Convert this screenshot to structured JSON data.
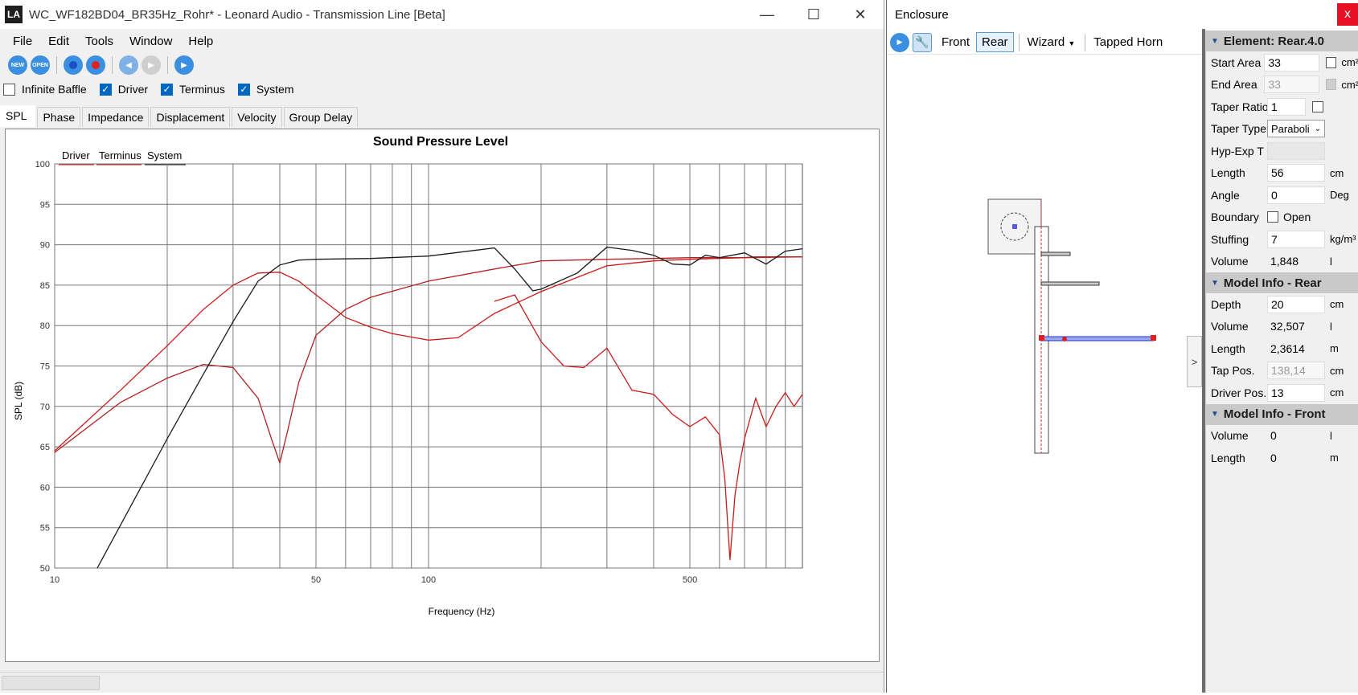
{
  "main_window": {
    "app_logo": "LA",
    "title": "WC_WF182BD04_BR35Hz_Rohr* - Leonard Audio - Transmission Line [Beta]",
    "menu": [
      "File",
      "Edit",
      "Tools",
      "Window",
      "Help"
    ],
    "toolbar_icons": [
      "new-icon",
      "open-icon",
      "record-icon",
      "stop-record-icon",
      "step-back-icon",
      "step-forward-icon",
      "play-icon"
    ],
    "toolbar_labels": {
      "new": "NEW",
      "open": "OPEN"
    },
    "checkboxes": [
      {
        "label": "Infinite Baffle",
        "checked": false
      },
      {
        "label": "Driver",
        "checked": true
      },
      {
        "label": "Terminus",
        "checked": true
      },
      {
        "label": "System",
        "checked": true
      }
    ],
    "tabs": [
      "SPL",
      "Phase",
      "Impedance",
      "Displacement",
      "Velocity",
      "Group Delay"
    ],
    "active_tab": "SPL"
  },
  "chart_data": {
    "type": "line",
    "title": "Sound Pressure Level",
    "xlabel": "Frequency (Hz)",
    "ylabel": "SPL (dB)",
    "x_scale": "log",
    "xlim": [
      10,
      1000
    ],
    "ylim": [
      50,
      100
    ],
    "x_tick_labels": [
      "10",
      "50",
      "100",
      "500"
    ],
    "x_ticks": [
      10,
      50,
      100,
      500
    ],
    "y_ticks": [
      50,
      55,
      60,
      65,
      70,
      75,
      80,
      85,
      90,
      95,
      100
    ],
    "grid": true,
    "legend_position": "top-left",
    "legend": [
      "Driver",
      "Terminus",
      "System"
    ],
    "series": [
      {
        "name": "Driver",
        "color": "#cc1a1a",
        "x": [
          10,
          15,
          20,
          25,
          30,
          35,
          40,
          45,
          50,
          60,
          70,
          80,
          100,
          120,
          150,
          200,
          300,
          400,
          500,
          700,
          1000
        ],
        "y": [
          64.5,
          72,
          77.5,
          82,
          85,
          86.5,
          86.6,
          85.5,
          83.8,
          81,
          79.8,
          79,
          78.2,
          78.5,
          81.5,
          84.2,
          87.4,
          88,
          88.2,
          88.4,
          88.5
        ]
      },
      {
        "name": "Terminus",
        "color": "#b22222",
        "x": [
          10,
          15,
          20,
          25,
          30,
          35,
          38,
          40,
          42,
          45,
          50,
          60,
          70,
          100,
          150,
          200,
          300,
          400,
          500,
          600,
          650,
          700,
          750,
          800,
          900,
          1000
        ],
        "y": [
          64.3,
          70.5,
          73.5,
          75.2,
          74.8,
          71,
          66,
          63,
          67,
          73,
          78.8,
          82,
          83.5,
          85.5,
          87,
          88,
          88.2,
          88.3,
          88.4,
          88.4,
          88.4,
          88.4,
          88.5,
          88.5,
          88.5,
          88.5
        ]
      },
      {
        "name": "System",
        "color": "#1a1a1a",
        "x": [
          13,
          20,
          25,
          30,
          35,
          40,
          45,
          50,
          70,
          100,
          150,
          170,
          190,
          200,
          250,
          300,
          350,
          400,
          450,
          500,
          550,
          600,
          700,
          800,
          900,
          1000
        ],
        "y": [
          50,
          66,
          74,
          80.5,
          85.5,
          87.5,
          88.1,
          88.2,
          88.3,
          88.6,
          89.6,
          87,
          84.3,
          84.5,
          86.5,
          89.7,
          89.3,
          88.7,
          87.6,
          87.5,
          88.7,
          88.4,
          89,
          87.6,
          89.2,
          89.5
        ]
      },
      {
        "name": "Driver-response-extra",
        "color": "#cc1a1a",
        "x": [
          150,
          170,
          200,
          230,
          260,
          300,
          350,
          400,
          450,
          500,
          550,
          600,
          620,
          640,
          660,
          680,
          700,
          750,
          800,
          850,
          900,
          950,
          1000
        ],
        "y": [
          83,
          83.8,
          78,
          75,
          74.8,
          77.2,
          72,
          71.5,
          69,
          67.5,
          68.7,
          66.5,
          61,
          51,
          59,
          63,
          66,
          71,
          67.5,
          70,
          71.7,
          70,
          71.5
        ]
      }
    ]
  },
  "enclosure_window": {
    "title": "Enclosure",
    "close": "x",
    "toolbar": [
      "Front",
      "Rear",
      "Wizard",
      "Tapped Horn"
    ],
    "selected_view": "Rear",
    "collapse_arrow": ">",
    "sections": [
      {
        "title": "Element: Rear.4.0",
        "rows": [
          {
            "label": "Start Area",
            "value": "33",
            "unit": "cm²",
            "checkbox": true
          },
          {
            "label": "End Area",
            "value": "33",
            "unit": "cm²",
            "checkbox": true,
            "disabled": true
          },
          {
            "label": "Taper Ratio",
            "value": "1",
            "unit": "",
            "checkbox": true
          },
          {
            "label": "Taper Type",
            "value": "Paraboli",
            "select": true
          },
          {
            "label": "Hyp-Exp T",
            "value": "",
            "disabled": true
          },
          {
            "label": "Length",
            "value": "56",
            "unit": "cm"
          },
          {
            "label": "Angle",
            "value": "0",
            "unit": "Deg"
          },
          {
            "label": "Boundary",
            "value": "Open",
            "open_checkbox": true
          },
          {
            "label": "Stuffing",
            "value": "7",
            "unit": "kg/m³"
          },
          {
            "label": "Volume",
            "value": "1,848",
            "unit": "l",
            "plain": true
          }
        ]
      },
      {
        "title": "Model Info - Rear",
        "rows": [
          {
            "label": "Depth",
            "value": "20",
            "unit": "cm"
          },
          {
            "label": "Volume",
            "value": "32,507",
            "unit": "l",
            "plain": true
          },
          {
            "label": "Length",
            "value": "2,3614",
            "unit": "m",
            "plain": true
          },
          {
            "label": "Tap Pos.",
            "value": "138,14",
            "unit": "cm",
            "disabled": true
          },
          {
            "label": "Driver Pos.",
            "value": "13",
            "unit": "cm"
          }
        ]
      },
      {
        "title": "Model Info - Front",
        "rows": [
          {
            "label": "Volume",
            "value": "0",
            "unit": "l",
            "plain": true
          },
          {
            "label": "Length",
            "value": "0",
            "unit": "m",
            "plain": true
          }
        ]
      }
    ]
  }
}
